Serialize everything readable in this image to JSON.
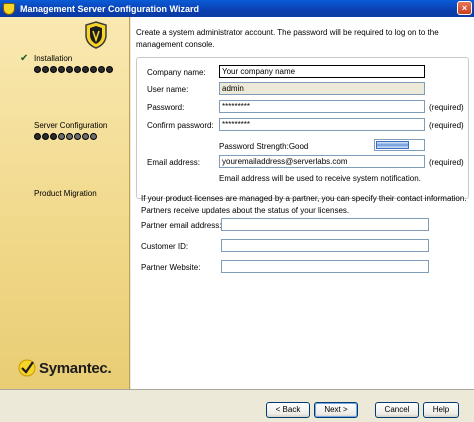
{
  "window": {
    "title": "Management Server Configuration Wizard",
    "close_glyph": "×"
  },
  "sidebar": {
    "steps": [
      {
        "label": "Installation",
        "completed": true,
        "check": "✔",
        "dots_filled": 10,
        "dots_total": 10
      },
      {
        "label": "Server Configuration",
        "completed": false,
        "dots_filled": 3,
        "dots_total": 8
      },
      {
        "label": "Product Migration",
        "completed": false
      }
    ],
    "brand": "Symantec."
  },
  "form": {
    "intro": "Create a system administrator account. The password will be required to log on to the management console.",
    "company_label": "Company name:",
    "company_value": "Your company name",
    "username_label": "User name:",
    "username_value": "admin",
    "password_label": "Password:",
    "password_value": "*********",
    "password_required": "(required)",
    "confirm_label": "Confirm password:",
    "confirm_value": "*********",
    "confirm_required": "(required)",
    "strength_label": "Password Strength:Good",
    "strength_fraction": 0.7,
    "email_label": "Email address:",
    "email_value": "youremailaddress@serverlabs.com",
    "email_required": "(required)",
    "email_note": "Email address will be used to receive system notification."
  },
  "partner": {
    "text": "If your product licenses are managed by a partner, you can specify their contact information. Partners receive updates about the status of your licenses.",
    "email_label": "Partner email address:",
    "email_value": "",
    "customer_id_label": "Customer ID:",
    "customer_id_value": "",
    "website_label": "Partner Website:",
    "website_value": ""
  },
  "buttons": {
    "back": "< Back",
    "next": "Next >",
    "cancel": "Cancel",
    "help": "Help"
  },
  "colors": {
    "titlebar": "#0a4fc6",
    "sidebar": "#f1d98c",
    "accent": "#f7d428"
  }
}
